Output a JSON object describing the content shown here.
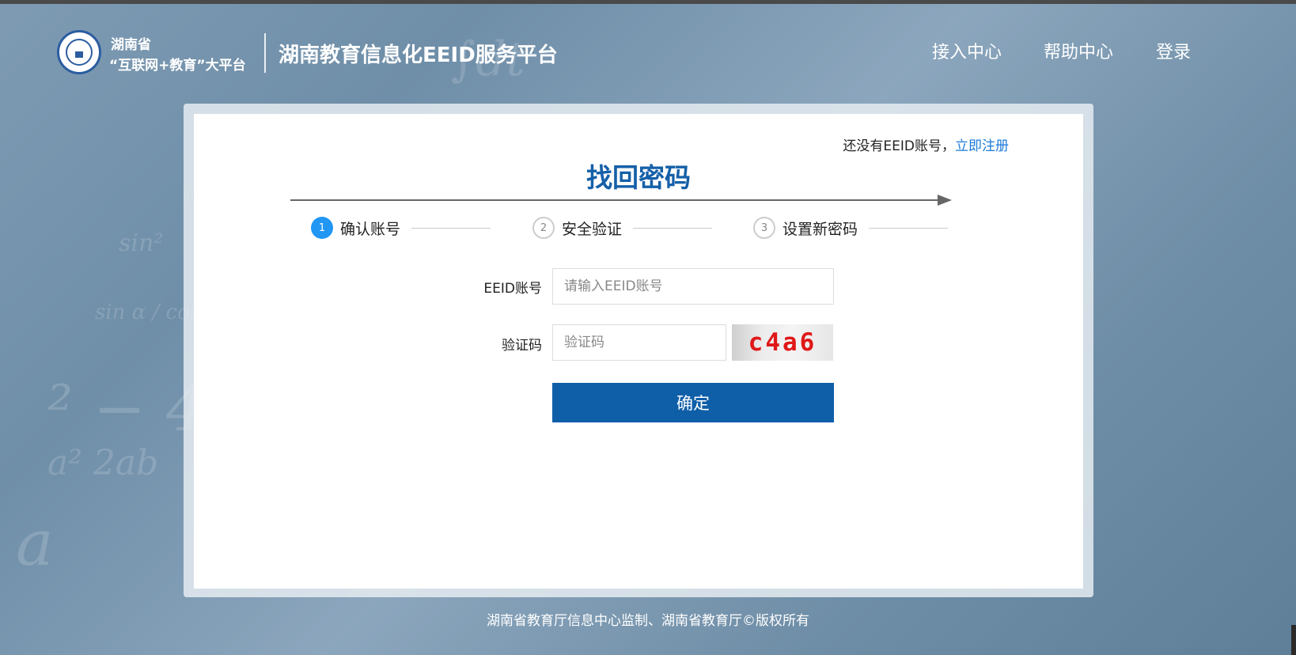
{
  "header": {
    "province": "湖南省",
    "platform_slogan": "“互联网+教育”大平台",
    "platform_title": "湖南教育信息化EEID服务平台",
    "nav": [
      {
        "label": "接入中心"
      },
      {
        "label": "帮助中心"
      },
      {
        "label": "登录"
      }
    ]
  },
  "card": {
    "register_prompt": "还没有EEID账号，",
    "register_link": "立即注册",
    "title": "找回密码",
    "steps": [
      {
        "number": "1",
        "label": "确认账号",
        "state": "active"
      },
      {
        "number": "2",
        "label": "安全验证",
        "state": "inactive"
      },
      {
        "number": "3",
        "label": "设置新密码",
        "state": "inactive"
      }
    ],
    "form": {
      "account_label": "EEID账号",
      "account_placeholder": "请输入EEID账号",
      "account_value": "",
      "captcha_label": "验证码",
      "captcha_placeholder": "验证码",
      "captcha_value": "",
      "captcha_text": "c4a6",
      "submit_label": "确定"
    }
  },
  "footer": {
    "copyright": "湖南省教育厅信息中心监制、湖南省教育厅©版权所有"
  },
  "colors": {
    "accent": "#1560a8",
    "button": "#0f5ea8",
    "link": "#1a7ad8",
    "step_active": "#2196f3",
    "captcha_text": "#e01818"
  }
}
